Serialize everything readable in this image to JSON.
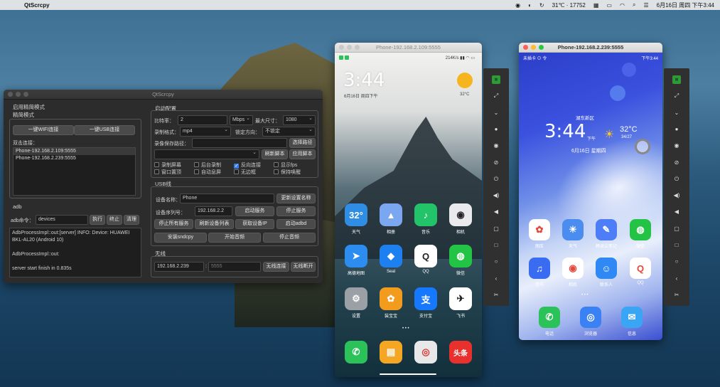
{
  "menubar": {
    "app_name": "QtScrcpy",
    "status_text": "31℃ · 17752",
    "datetime": "6月16日 周四 下午3:44"
  },
  "qt": {
    "title": "QtScrcpy",
    "simple_mode_group": "启用精简模式",
    "simple_mode_label": "精简模式",
    "wifi_btn": "一键WIFI连接",
    "usb_btn": "一键USB连接",
    "double_click_label": "双击连接：",
    "devices": [
      "Phone-192.168.2.109:5555",
      "Phone-192.168.2.239:5555"
    ],
    "adb_group": "adb",
    "adb_cmd_label": "adb命令：",
    "adb_cmd_value": "devices",
    "exec_btn": "执行",
    "stop_btn": "终止",
    "clear_btn": "清理",
    "log": [
      "AdbProcessImpl::out:[server] INFO: Device: HUAWEI BKL-AL20 (Android 10)",
      "",
      "AdbProcessImpl::out:",
      "",
      "server start finish in 0.835s"
    ],
    "start_config": "启动配置",
    "bitrate_label": "比特率：",
    "bitrate_value": "2",
    "bitrate_unit": "Mbps",
    "max_size_label": "最大尺寸：",
    "max_size_value": "1080",
    "record_fmt_label": "录制格式：",
    "record_fmt_value": "mp4",
    "lock_dir_label": "锁定方向：",
    "lock_dir_value": "不锁定",
    "record_path_label": "录像保存路径：",
    "select_path_btn": "选择路径",
    "refresh_script_btn": "刷新脚本",
    "apply_script_btn": "应用脚本",
    "checks": [
      {
        "label": "录制屏幕",
        "checked": false
      },
      {
        "label": "后台录制",
        "checked": false
      },
      {
        "label": "反向连接",
        "checked": true
      },
      {
        "label": "显示fps",
        "checked": false
      },
      {
        "label": "窗口置顶",
        "checked": false
      },
      {
        "label": "自动息屏",
        "checked": false
      },
      {
        "label": "无边框",
        "checked": false
      },
      {
        "label": "保持唤醒",
        "checked": false
      }
    ],
    "usb_group": "USB线",
    "dev_name_label": "设备名称：",
    "dev_name_value": "Phone",
    "update_name_btn": "更新设置名称",
    "serial_label": "设备序列号：",
    "serial_value": "192.168.2.2",
    "start_service_btn": "启动服务",
    "stop_service_btn": "停止服务",
    "stop_all_btn": "停止所有服务",
    "refresh_dev_btn": "刷新设备列表",
    "get_ip_btn": "获取设备IP",
    "start_adbd_btn": "启动adbd",
    "install_btn": "安装sndcpy",
    "start_audio_btn": "开始音频",
    "stop_audio_btn": "停止音频",
    "wireless_group": "无线",
    "ip_value": "192.168.2.239",
    "port_placeholder": "5555",
    "wireless_connect_btn": "无线连接",
    "wireless_disconnect_btn": "无线断开"
  },
  "phone1": {
    "title": "Phone-192.168.2.109:5555",
    "time": "3:44",
    "date": "6月16日 周四下午",
    "temp": "32°C",
    "status": "214K/s",
    "apps": [
      {
        "label": "天气",
        "icon": "32°",
        "color": "#2f8de4"
      },
      {
        "label": "相册",
        "icon": "▲",
        "color": "#7aa7f0"
      },
      {
        "label": "音乐",
        "icon": "♪",
        "color": "#23c36a"
      },
      {
        "label": "相机",
        "icon": "◉",
        "color": "#e9e9ee"
      },
      {
        "label": "高德地图",
        "icon": "➤",
        "color": "#2d8cf0"
      },
      {
        "label": "Seal",
        "icon": "◆",
        "color": "#1e7ff0"
      },
      {
        "label": "QQ",
        "icon": "Q",
        "color": "#ffffff"
      },
      {
        "label": "微信",
        "icon": "◍",
        "color": "#23c345"
      },
      {
        "label": "设置",
        "icon": "⚙",
        "color": "#9aa0a6"
      },
      {
        "label": "装宝宝",
        "icon": "✿",
        "color": "#f29b1d"
      },
      {
        "label": "支付宝",
        "icon": "支",
        "color": "#1677ff"
      },
      {
        "label": "飞书",
        "icon": "✈",
        "color": "#ffffff"
      }
    ],
    "dock": [
      {
        "icon": "✆",
        "color": "#2cc25a"
      },
      {
        "icon": "▤",
        "color": "#f5a623"
      },
      {
        "icon": "◎",
        "color": "#e8e8e8"
      },
      {
        "icon": "头条",
        "color": "#e8312d"
      }
    ]
  },
  "phone2": {
    "title": "Phone-192.168.2.239:5555",
    "carrier": "未插卡 ⊙ 令",
    "status_time": "下午3:44",
    "time": "3:44",
    "ampm": "下午",
    "city": "湖东新区",
    "temp": "32°C",
    "temp_range": "34/27",
    "date": "6月16日 星期四",
    "apps": [
      {
        "label": "图库",
        "icon": "✿",
        "color": "#ffffff"
      },
      {
        "label": "天气",
        "icon": "☀",
        "color": "#4a8cf0"
      },
      {
        "label": "畅读云笔记",
        "icon": "✎",
        "color": "#4d7ef7"
      },
      {
        "label": "微信",
        "icon": "◍",
        "color": "#23c345"
      },
      {
        "label": "音乐",
        "icon": "♫",
        "color": "#3a6cf2"
      },
      {
        "label": "相机",
        "icon": "◉",
        "color": "#ffffff"
      },
      {
        "label": "联系人",
        "icon": "☺",
        "color": "#2f88f4"
      },
      {
        "label": "QQ",
        "icon": "Q",
        "color": "#ffffff"
      }
    ],
    "dock": [
      {
        "label": "电话",
        "icon": "✆",
        "color": "#2cc25a"
      },
      {
        "label": "浏览器",
        "icon": "◎",
        "color": "#3a82f4"
      },
      {
        "label": "信息",
        "icon": "✉",
        "color": "#3aa4f5"
      }
    ]
  },
  "sidebar_icons": [
    "home-icon",
    "fullscreen-icon",
    "expand-icon",
    "record-icon",
    "eye-icon",
    "eye-off-icon",
    "power-icon",
    "volume-up-icon",
    "volume-down-icon",
    "recent-apps-icon",
    "back-square-icon",
    "circle-home-icon",
    "back-arrow-icon",
    "screenshot-icon"
  ]
}
